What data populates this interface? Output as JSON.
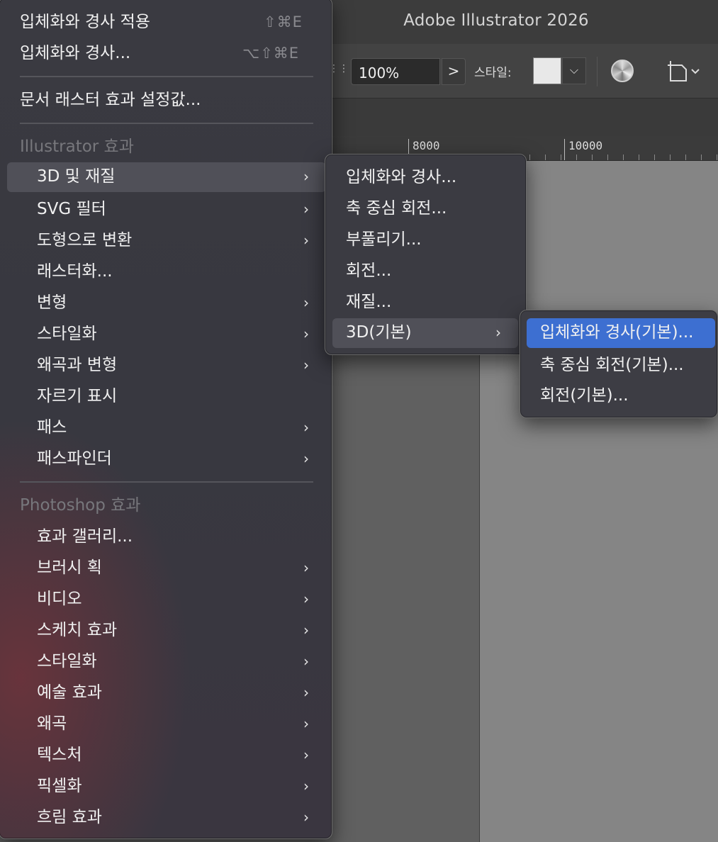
{
  "app": {
    "title": "Adobe Illustrator 2026"
  },
  "controlbar": {
    "opacity_value": "100%",
    "opacity_arrow": ">",
    "style_label": "스타일:",
    "style_dropdown": "⌵"
  },
  "ruler": {
    "labels": [
      "8000",
      "10000"
    ]
  },
  "main_menu": {
    "top_items": [
      {
        "label": "입체화와 경사 적용",
        "shortcut": "⇧⌘E"
      },
      {
        "label": "입체화와 경사...",
        "shortcut": "⌥⇧⌘E"
      },
      {
        "label": "문서 래스터 효과 설정값..."
      }
    ],
    "illustrator_header": "Illustrator 효과",
    "illustrator_items": [
      {
        "label": "3D 및 재질",
        "submenu": true,
        "highlighted": true
      },
      {
        "label": "SVG 필터",
        "submenu": true
      },
      {
        "label": "도형으로 변환",
        "submenu": true
      },
      {
        "label": "래스터화...",
        "submenu": false
      },
      {
        "label": "변형",
        "submenu": true
      },
      {
        "label": "스타일화",
        "submenu": true
      },
      {
        "label": "왜곡과 변형",
        "submenu": true
      },
      {
        "label": "자르기 표시",
        "submenu": false
      },
      {
        "label": "패스",
        "submenu": true
      },
      {
        "label": "패스파인더",
        "submenu": true
      }
    ],
    "photoshop_header": "Photoshop 효과",
    "photoshop_items": [
      {
        "label": "효과 갤러리...",
        "submenu": false
      },
      {
        "label": "브러시 획",
        "submenu": true
      },
      {
        "label": "비디오",
        "submenu": true
      },
      {
        "label": "스케치 효과",
        "submenu": true
      },
      {
        "label": "스타일화",
        "submenu": true
      },
      {
        "label": "예술 효과",
        "submenu": true
      },
      {
        "label": "왜곡",
        "submenu": true
      },
      {
        "label": "텍스처",
        "submenu": true
      },
      {
        "label": "픽셀화",
        "submenu": true
      },
      {
        "label": "흐림 효과",
        "submenu": true
      }
    ]
  },
  "submenu_3d": {
    "items": [
      {
        "label": "입체화와 경사..."
      },
      {
        "label": "축 중심 회전..."
      },
      {
        "label": "부풀리기..."
      },
      {
        "label": "회전..."
      },
      {
        "label": "재질..."
      },
      {
        "label": "3D(기본)",
        "submenu": true,
        "highlighted": true
      }
    ]
  },
  "submenu_3d_classic": {
    "items": [
      {
        "label": "입체화와 경사(기본)...",
        "selected": true
      },
      {
        "label": "축 중심 회전(기본)..."
      },
      {
        "label": "회전(기본)..."
      }
    ]
  },
  "chevron": "›"
}
